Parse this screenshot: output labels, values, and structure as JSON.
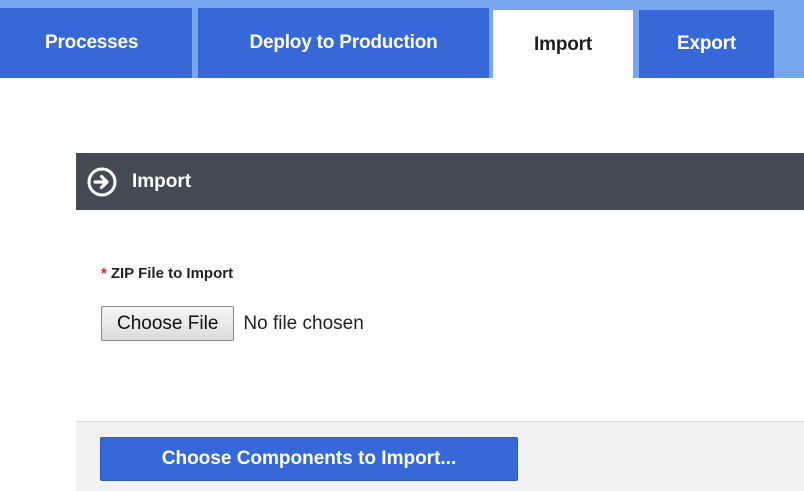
{
  "tabs": [
    {
      "label": "Processes",
      "active": false
    },
    {
      "label": "Deploy to Production",
      "active": false
    },
    {
      "label": "Import",
      "active": true
    },
    {
      "label": "Export",
      "active": false
    }
  ],
  "panel": {
    "icon": "arrow-right-circle-icon",
    "title": "Import"
  },
  "form": {
    "required_marker": "*",
    "file_label": "ZIP File to Import",
    "choose_file_label": "Choose File",
    "file_status": "No file chosen"
  },
  "footer": {
    "components_button_label": "Choose Components to Import..."
  },
  "colors": {
    "tab_blue": "#3668d8",
    "tabbar_light": "#78a6ec",
    "header_dark": "#444a53",
    "required_red": "#d4262a"
  }
}
